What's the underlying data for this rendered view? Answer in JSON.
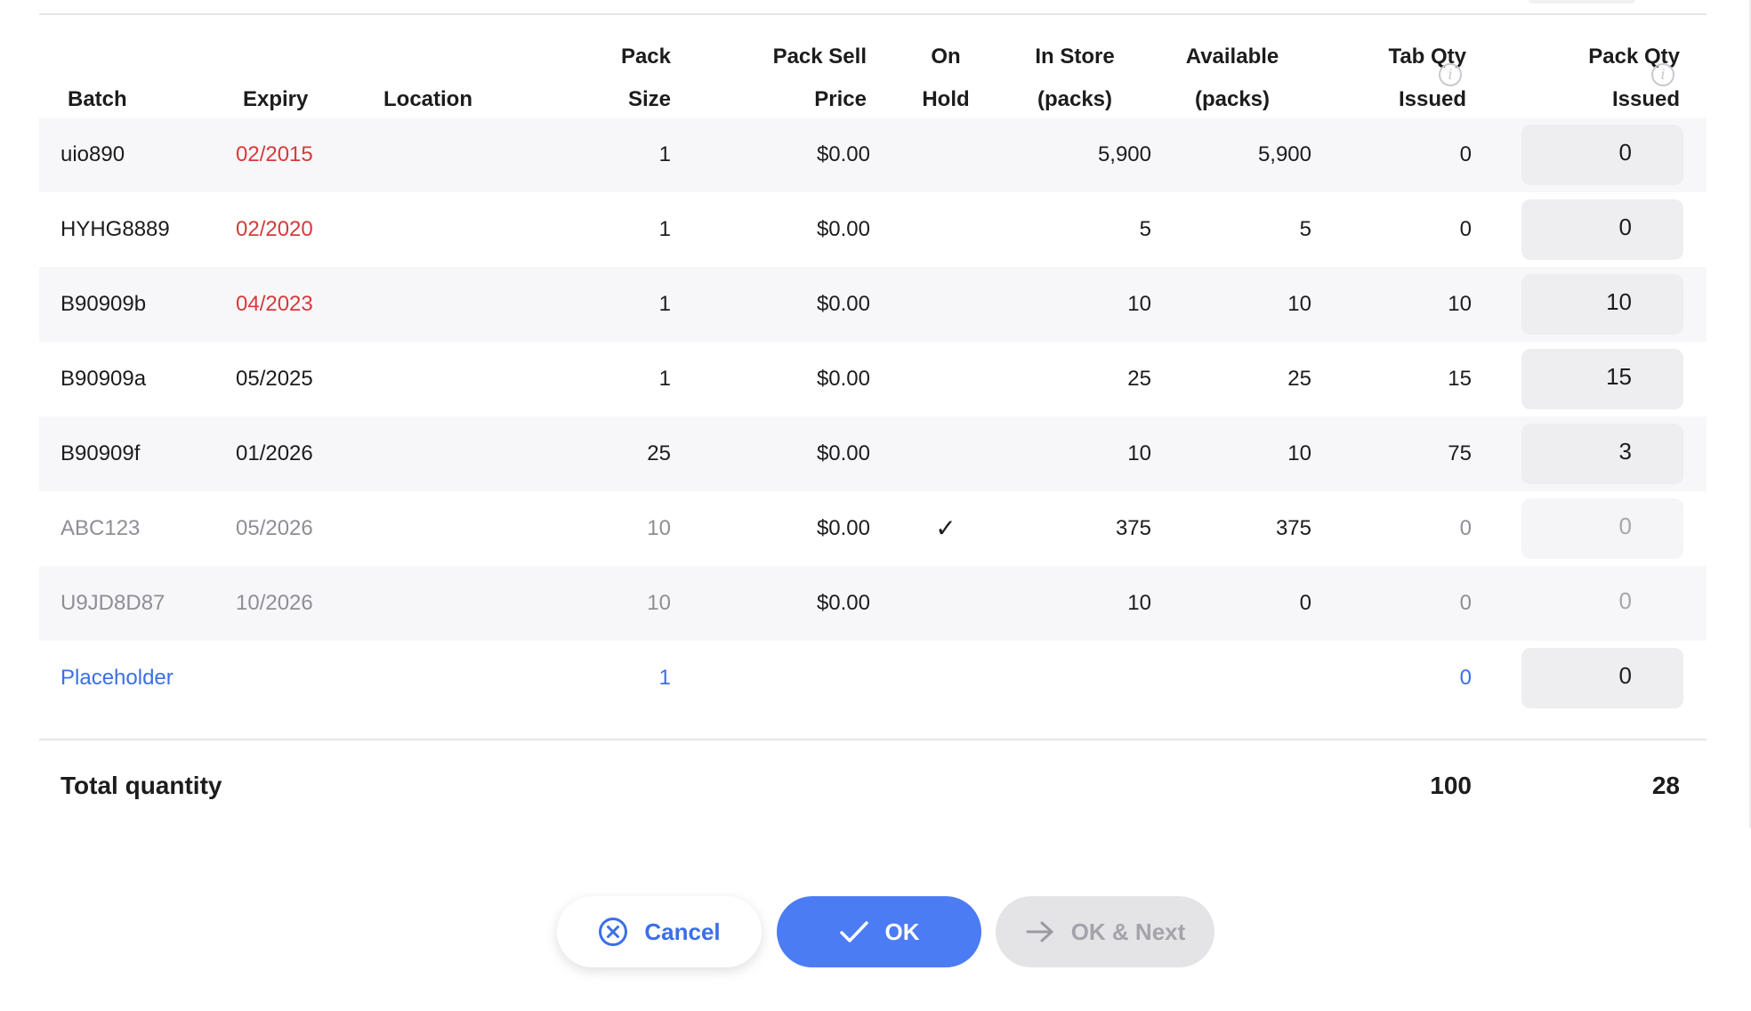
{
  "table": {
    "headers": {
      "batch": [
        "",
        "Batch"
      ],
      "expiry": [
        "",
        "Expiry"
      ],
      "location": [
        "",
        "Location"
      ],
      "pack_size": [
        "Pack",
        "Size"
      ],
      "sell_price": [
        "Pack Sell",
        "Price"
      ],
      "on_hold": [
        "On",
        "Hold"
      ],
      "in_store": [
        "In Store",
        "(packs)"
      ],
      "available": [
        "Available",
        "(packs)"
      ],
      "tab_qty": [
        "Tab Qty",
        "Issued"
      ],
      "pack_qty": [
        "Pack Qty",
        "Issued"
      ]
    },
    "rows": [
      {
        "batch": "uio890",
        "expiry": "02/2015",
        "location": "",
        "pack_size": "1",
        "price": "$0.00",
        "on_hold": "",
        "in_store": "5,900",
        "available": "5,900",
        "tab_qty": "0",
        "pack_qty": "0"
      },
      {
        "batch": "HYHG8889",
        "expiry": "02/2020",
        "location": "",
        "pack_size": "1",
        "price": "$0.00",
        "on_hold": "",
        "in_store": "5",
        "available": "5",
        "tab_qty": "0",
        "pack_qty": "0"
      },
      {
        "batch": "B90909b",
        "expiry": "04/2023",
        "location": "",
        "pack_size": "1",
        "price": "$0.00",
        "on_hold": "",
        "in_store": "10",
        "available": "10",
        "tab_qty": "10",
        "pack_qty": "10"
      },
      {
        "batch": "B90909a",
        "expiry": "05/2025",
        "location": "",
        "pack_size": "1",
        "price": "$0.00",
        "on_hold": "",
        "in_store": "25",
        "available": "25",
        "tab_qty": "15",
        "pack_qty": "15"
      },
      {
        "batch": "B90909f",
        "expiry": "01/2026",
        "location": "",
        "pack_size": "25",
        "price": "$0.00",
        "on_hold": "",
        "in_store": "10",
        "available": "10",
        "tab_qty": "75",
        "pack_qty": "3"
      },
      {
        "batch": "ABC123",
        "expiry": "05/2026",
        "location": "",
        "pack_size": "10",
        "price": "$0.00",
        "on_hold": "✓",
        "in_store": "375",
        "available": "375",
        "tab_qty": "0",
        "pack_qty": "0"
      },
      {
        "batch": "U9JD8D87",
        "expiry": "10/2026",
        "location": "",
        "pack_size": "10",
        "price": "$0.00",
        "on_hold": "",
        "in_store": "10",
        "available": "0",
        "tab_qty": "0",
        "pack_qty": "0"
      },
      {
        "batch": "Placeholder",
        "expiry": "",
        "location": "",
        "pack_size": "1",
        "price": "",
        "on_hold": "",
        "in_store": "",
        "available": "",
        "tab_qty": "0",
        "pack_qty": "0"
      }
    ],
    "total": {
      "label": "Total quantity",
      "tab_qty": "100",
      "pack_qty": "28"
    }
  },
  "buttons": {
    "cancel": "Cancel",
    "ok": "OK",
    "ok_next": "OK & Next"
  },
  "colors": {
    "accent": "#4b7cf3",
    "expired": "#d63a3a",
    "muted": "#8e8e96"
  },
  "icons": {
    "info": "info-icon",
    "cancel": "circle-x-icon",
    "ok": "check-icon",
    "next": "arrow-right-icon"
  }
}
